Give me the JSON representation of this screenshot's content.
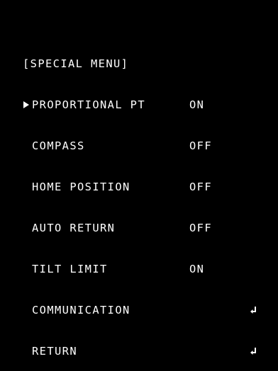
{
  "menu": {
    "title": "[SPECIAL MENU]",
    "items": [
      {
        "label": "PROPORTIONAL PT",
        "value": "ON",
        "selected": true
      },
      {
        "label": "COMPASS",
        "value": "OFF",
        "selected": false
      },
      {
        "label": "HOME POSITION",
        "value": "OFF",
        "selected": false
      },
      {
        "label": "AUTO RETURN",
        "value": "OFF",
        "selected": false
      },
      {
        "label": "TILT LIMIT",
        "value": "ON",
        "selected": false
      },
      {
        "label": "COMMUNICATION",
        "value": "",
        "icon": "enter-icon",
        "selected": false
      },
      {
        "label": "RETURN",
        "value": "",
        "icon": "enter-icon",
        "selected": false
      }
    ]
  },
  "colors": {
    "background": "#000000",
    "text": "#ffffff"
  }
}
